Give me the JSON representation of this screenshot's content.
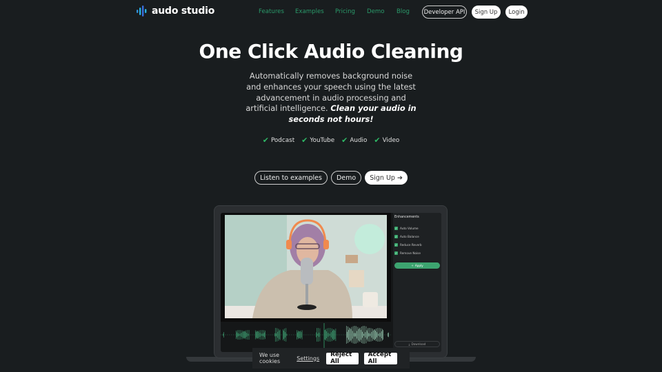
{
  "brand": {
    "name": "audo studio",
    "logo_icon": "sound-bars-icon",
    "logo_colors": [
      "#2f8fd8",
      "#27b3e6",
      "#3a6fe0"
    ]
  },
  "nav": {
    "links": [
      "Features",
      "Examples",
      "Pricing",
      "Demo",
      "Blog"
    ],
    "developer_api": "Developer API",
    "sign_up": "Sign Up",
    "login": "Login",
    "link_color": "#2a9a6a"
  },
  "hero": {
    "title": "One Click Audio Cleaning",
    "subtitle": "Automatically removes background noise and enhances your speech using the latest advancement in audio processing and artificial intelligence.",
    "subtitle_emphasis": "Clean your audio in seconds not hours!",
    "tags": [
      "Podcast",
      "YouTube",
      "Audio",
      "Video"
    ],
    "tag_icon": "check-icon",
    "ctas": {
      "listen": "Listen to examples",
      "demo": "Demo",
      "sign_up": "Sign Up",
      "sign_up_icon": "arrow-right-icon"
    }
  },
  "app_preview": {
    "panel_title": "Enhancements",
    "options": [
      {
        "label": "Auto Volume",
        "checked": true
      },
      {
        "label": "Auto Balance",
        "checked": true
      },
      {
        "label": "Reduce Reverb",
        "checked": true
      },
      {
        "label": "Remove Noise",
        "checked": true
      }
    ],
    "apply_label": "Apply",
    "download_label": "Download",
    "accent": "#3da470"
  },
  "cookies": {
    "text": "We use cookies",
    "settings": "Settings",
    "reject": "Reject All",
    "accept": "Accept All"
  }
}
